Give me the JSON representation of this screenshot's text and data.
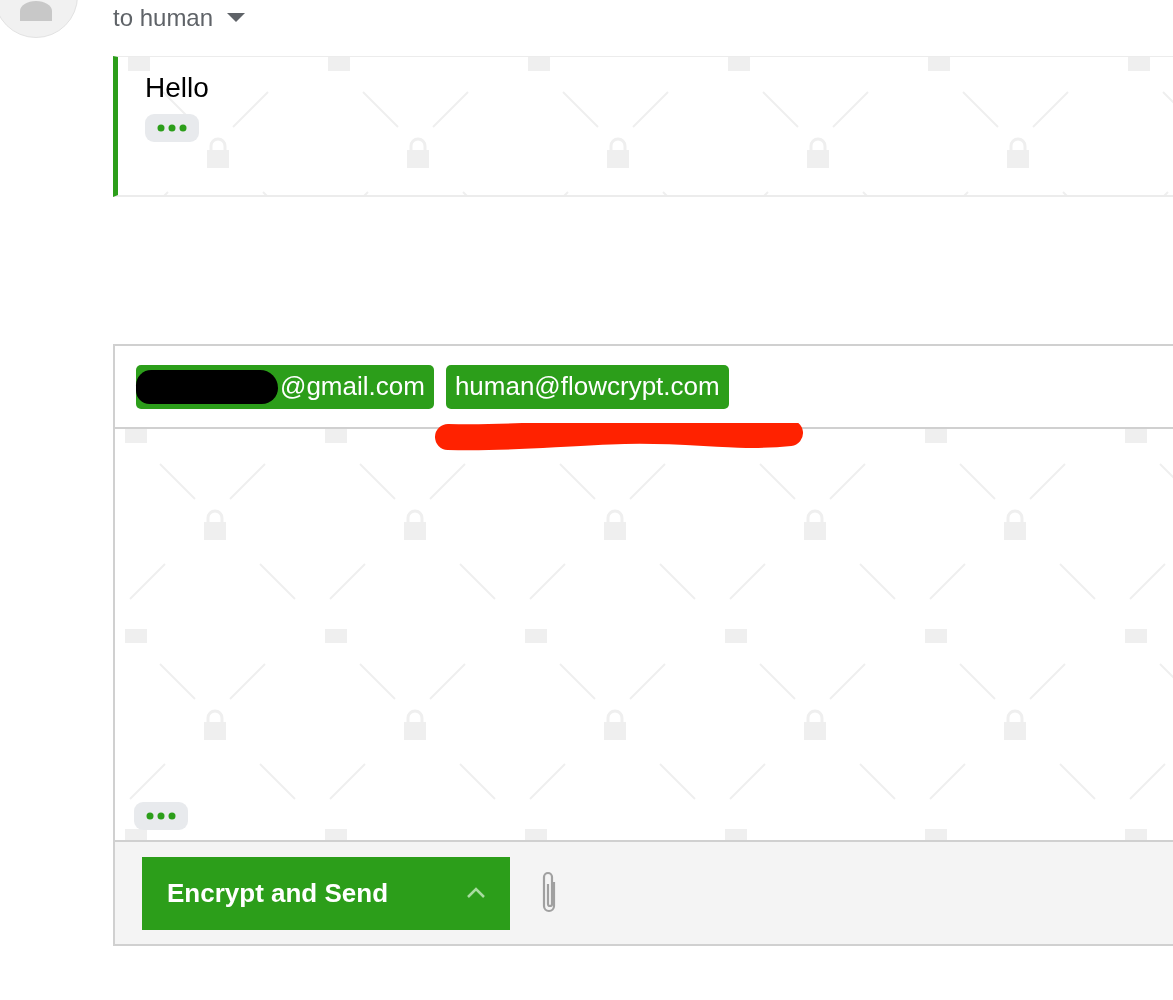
{
  "header": {
    "recipient_summary": "to human"
  },
  "quoted_message": {
    "text": "Hello"
  },
  "compose": {
    "recipients": [
      {
        "email": "@gmail.com",
        "redacted": true,
        "marked": false
      },
      {
        "email": "human@flowcrypt.com",
        "redacted": false,
        "marked": true
      }
    ],
    "send_button": {
      "label": "Encrypt and Send"
    }
  }
}
